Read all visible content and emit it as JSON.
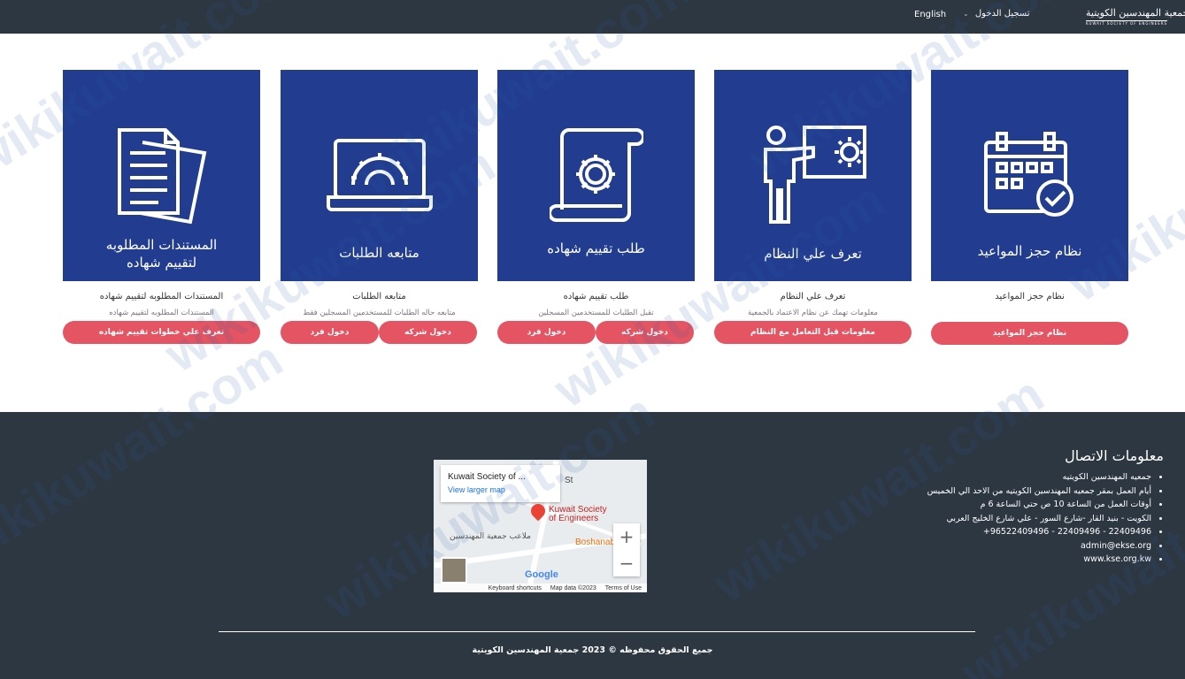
{
  "header": {
    "logo_ar": "جمعية المهندسين الكويتية",
    "logo_en": "KUWAIT SOCIETY OF ENGINEERS",
    "login_label": "تسجيل الدخول",
    "language_label": "English"
  },
  "cards": [
    {
      "tile_title": "نظام حجز المواعيد",
      "title": "نظام حجز المواعيد",
      "description": "",
      "buttons": [
        "نظام حجز المواعيد"
      ],
      "icon": "calendar-check-icon"
    },
    {
      "tile_title": "تعرف علي النظام",
      "title": "تعرف علي النظام",
      "description": "معلومات تهمك عن نظام الاعتماد بالجمعية",
      "buttons": [
        "معلومات قبل التعامل مع النظام"
      ],
      "icon": "presenter-gear-icon"
    },
    {
      "tile_title": "طلب تقييم شهاده",
      "title": "طلب تقييم شهاده",
      "description": "تقبل الطلبات للمستخدمين المسجلين",
      "buttons": [
        "دخول شركه",
        "دخول فرد"
      ],
      "icon": "scroll-gear-icon"
    },
    {
      "tile_title": "متابعه الطلبات",
      "title": "متابعه الطلبات",
      "description": "متابعه حاله الطلبات للمستخدمين المسجلين فقط",
      "buttons": [
        "دخول شركه",
        "دخول فرد"
      ],
      "icon": "laptop-gear-icon"
    },
    {
      "tile_title_line1": "المستندات المطلوبه",
      "tile_title_line2": "لتقييم شهاده",
      "title": "المستندات المطلوبه لتقييم شهاده",
      "description": "المستندات المطلوبه لتقييم شهاده",
      "buttons": [
        "تعرف علي خطوات تقييم شهاده"
      ],
      "icon": "documents-icon"
    }
  ],
  "footer": {
    "contact_title": "معلومات الاتصال",
    "contact_items": [
      "جمعيه المهندسين الكويتيه",
      "أيام العمل بمقر جمعيه المهندسين الكويتيه من الاحد الي الخميس",
      "أوقات العمل من الساعة 10 ص حتي الساعة 6 م",
      "الكويت - بنيد القار -شارع السور - علي شارع الخليج العربي",
      "22409496 - 22409496 - 96522409496+",
      "admin@ekse.org",
      "www.kse.org.kw"
    ],
    "map": {
      "place_name": "Kuwait Society of ...",
      "larger_map_link": "View larger map",
      "pin_label_line1": "Kuwait Society",
      "pin_label_line2": "of Engineers",
      "street": "St",
      "poi": "Boshanab",
      "ar_label": "ملاعب جمعية المهندسين",
      "zoom_in": "+",
      "zoom_out": "−",
      "google": "Google",
      "keyboard": "Keyboard shortcuts",
      "map_data": "Map data ©2023",
      "terms": "Terms of Use"
    },
    "copyright": "جميع الحقوق محفوظه © 2023 جمعية المهندسين الكويتية"
  },
  "watermark_text": "wikikuwait.com"
}
